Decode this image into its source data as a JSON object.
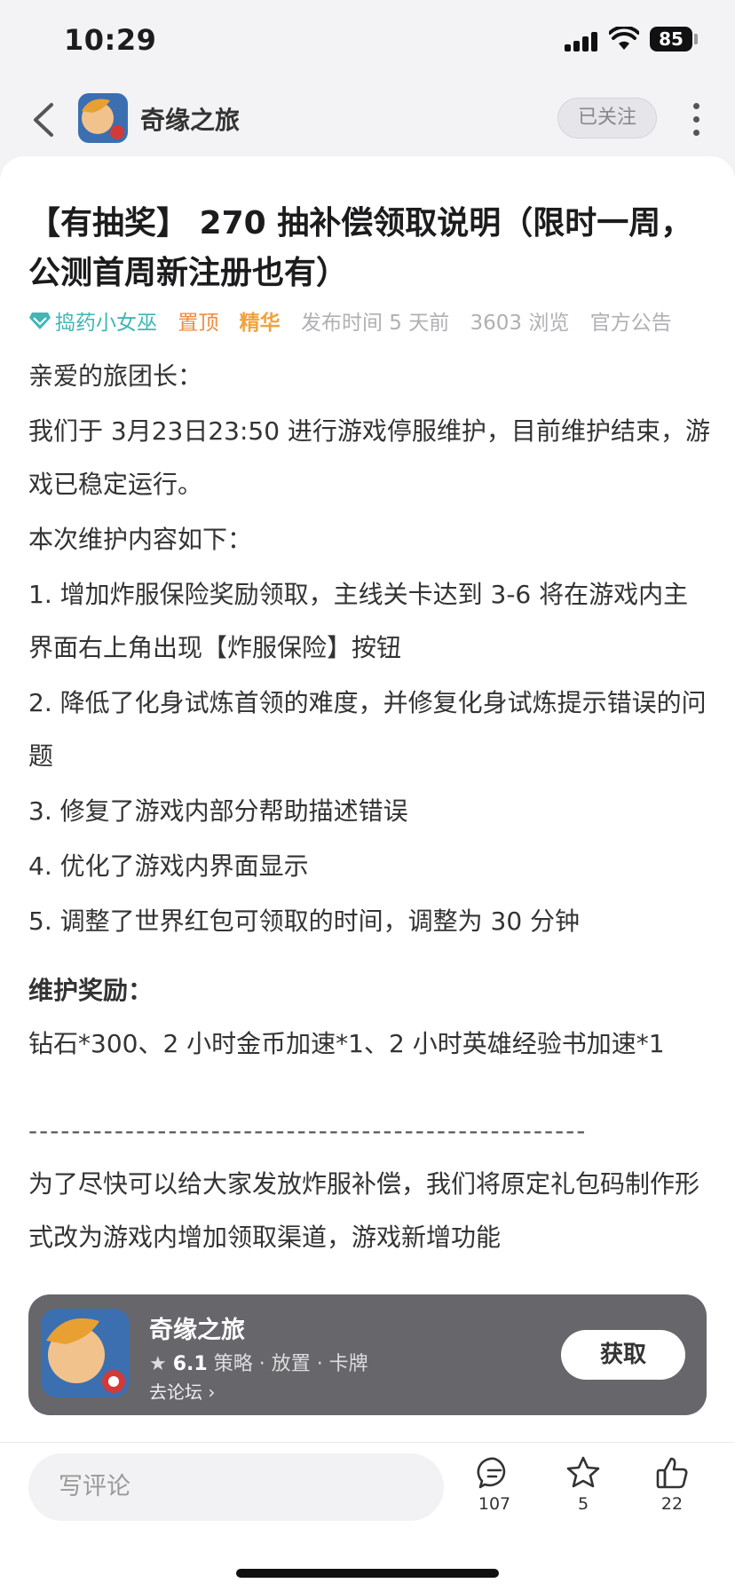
{
  "status": {
    "time": "10:29",
    "battery": "85"
  },
  "nav": {
    "app_name": "奇缘之旅",
    "follow_label": "已关注"
  },
  "post": {
    "title": "【有抽奖】 270 抽补偿领取说明（限时一周，公测首周新注册也有）",
    "author": "捣药小女巫",
    "tag_pinned": "置顶",
    "tag_featured": "精华",
    "published": "发布时间 5 天前",
    "views": "3603 浏览",
    "category": "官方公告",
    "paragraphs": [
      "亲爱的旅团长：",
      "我们于 3月23日23:50 进行游戏停服维护，目前维护结束，游戏已稳定运行。",
      "本次维护内容如下：",
      "1. 增加炸服保险奖励领取，主线关卡达到 3-6 将在游戏内主界面右上角出现【炸服保险】按钮",
      "2. 降低了化身试炼首领的难度，并修复化身试炼提示错误的问题",
      "3. 修复了游戏内部分帮助描述错误",
      "4. 优化了游戏内界面显示",
      "5. 调整了世界红包可领取的时间，调整为 30 分钟"
    ],
    "reward_heading": "维护奖励：",
    "reward_text": "钻石*300、2 小时金币加速*1、2 小时英雄经验书加速*1",
    "divider": "----------------------------------------------------",
    "tail_text": "为了尽快可以给大家发放炸服补偿，我们将原定礼包码制作形式改为游戏内增加领取渠道，游戏新增功能"
  },
  "promo": {
    "name": "奇缘之旅",
    "rating": "6.1",
    "tags": "策略 · 放置 · 卡牌",
    "forum_link": "去论坛",
    "get_label": "获取"
  },
  "bottom": {
    "comment_placeholder": "写评论",
    "comments": "107",
    "favorites": "5",
    "likes": "22"
  }
}
